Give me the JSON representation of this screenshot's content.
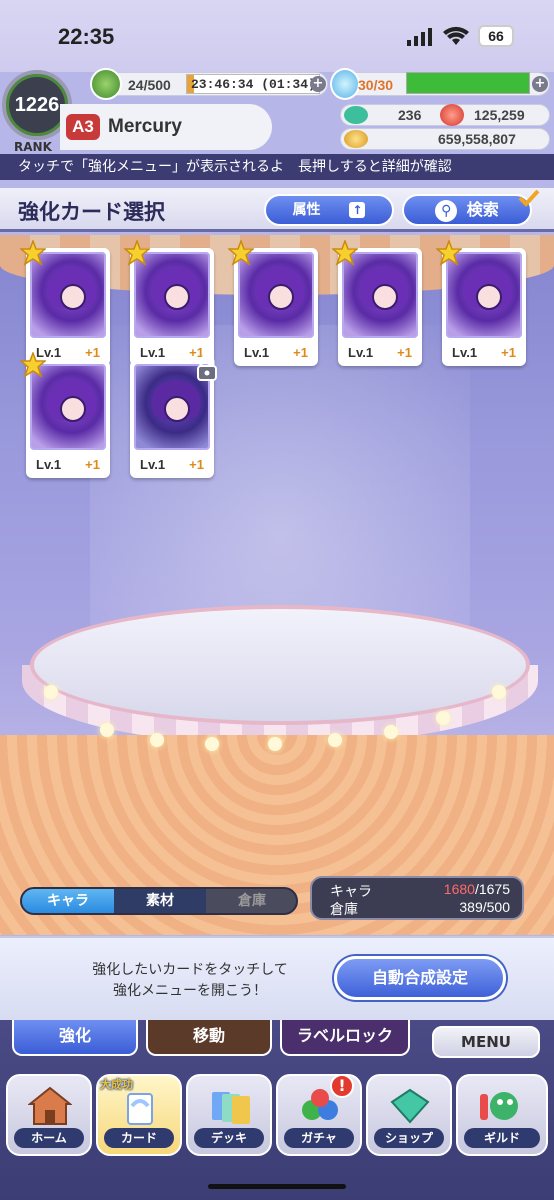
{
  "status_bar": {
    "time": "22:35",
    "battery": "66"
  },
  "header": {
    "rank": "1226",
    "rank_label": "RANK",
    "stamina": "24/500",
    "timer": "23:46:34 (01:34)",
    "heart": "30/30",
    "heart_fraction": 1.0,
    "gem_count": "236",
    "orb_count": "125,259",
    "coins": "659,558,807",
    "league_badge": "A3",
    "player_name": "Mercury"
  },
  "ticker": "タッチで「強化メニュー」が表示されるよ　長押しすると詳細が確認",
  "page": {
    "title": "強化カード選択",
    "attr_button": "属性",
    "search_button": "検索"
  },
  "cards": [
    {
      "level": "Lv.1",
      "plus": "+1",
      "starred": true,
      "locked": false
    },
    {
      "level": "Lv.1",
      "plus": "+1",
      "starred": true,
      "locked": false
    },
    {
      "level": "Lv.1",
      "plus": "+1",
      "starred": true,
      "locked": false
    },
    {
      "level": "Lv.1",
      "plus": "+1",
      "starred": true,
      "locked": false
    },
    {
      "level": "Lv.1",
      "plus": "+1",
      "starred": true,
      "locked": false
    },
    {
      "level": "Lv.1",
      "plus": "+1",
      "starred": true,
      "locked": false
    },
    {
      "level": "Lv.1",
      "plus": "+1",
      "starred": false,
      "locked": true
    }
  ],
  "tabs": {
    "chara": "キャラ",
    "material": "素材",
    "storage": "倉庫"
  },
  "counts": {
    "chara_label": "キャラ",
    "chara_current": "1680",
    "chara_max": "/1675",
    "storage_label": "倉庫",
    "storage_value": "389/500"
  },
  "hint": {
    "line1": "強化したいカードをタッチして",
    "line2": "強化メニューを開こう！"
  },
  "auto_button": "自動合成設定",
  "sub_tabs": {
    "enhance": "強化",
    "move": "移動",
    "label_lock": "ラベルロック",
    "menu": "MENU"
  },
  "nav": {
    "home": "ホーム",
    "card": "カード",
    "deck": "デッキ",
    "gacha": "ガチャ",
    "shop": "ショップ",
    "guild": "ギルド",
    "bonus": "大成功",
    "alert": "!"
  },
  "colors": {
    "accent": "#3b5dd6",
    "stage": "#9999dc",
    "nav_bg": "#3c3d74"
  }
}
